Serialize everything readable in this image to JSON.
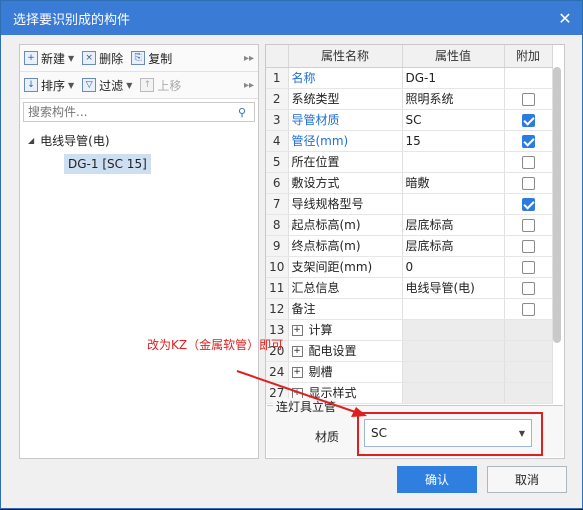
{
  "window": {
    "title": "选择要识别成的构件",
    "close_glyph": "✕"
  },
  "toolbar1": {
    "new_label": "新建",
    "delete_label": "删除",
    "copy_label": "复制"
  },
  "toolbar2": {
    "sort_label": "排序",
    "filter_label": "过滤",
    "up_label": "上移"
  },
  "search": {
    "placeholder": "搜索构件..."
  },
  "tree": {
    "parent_label": "电线导管(电)",
    "child_label": "DG-1 [SC 15]"
  },
  "table": {
    "headers": {
      "name": "属性名称",
      "value": "属性值",
      "extra": "附加"
    },
    "rows": [
      {
        "num": "1",
        "name": "名称",
        "value": "DG-1",
        "blue": true,
        "check": "none"
      },
      {
        "num": "2",
        "name": "系统类型",
        "value": "照明系统",
        "blue": false,
        "check": "off"
      },
      {
        "num": "3",
        "name": "导管材质",
        "value": "SC",
        "blue": true,
        "check": "on"
      },
      {
        "num": "4",
        "name": "管径(mm)",
        "value": "15",
        "blue": true,
        "check": "on"
      },
      {
        "num": "5",
        "name": "所在位置",
        "value": "",
        "blue": false,
        "check": "off"
      },
      {
        "num": "6",
        "name": "敷设方式",
        "value": "暗敷",
        "blue": false,
        "check": "off"
      },
      {
        "num": "7",
        "name": "导线规格型号",
        "value": "",
        "blue": false,
        "check": "on"
      },
      {
        "num": "8",
        "name": "起点标高(m)",
        "value": "层底标高",
        "blue": false,
        "check": "off"
      },
      {
        "num": "9",
        "name": "终点标高(m)",
        "value": "层底标高",
        "blue": false,
        "check": "off"
      },
      {
        "num": "10",
        "name": "支架间距(mm)",
        "value": "0",
        "blue": false,
        "check": "off"
      },
      {
        "num": "11",
        "name": "汇总信息",
        "value": "电线导管(电)",
        "blue": false,
        "check": "off"
      },
      {
        "num": "12",
        "name": "备注",
        "value": "",
        "blue": false,
        "check": "off"
      }
    ],
    "groups": [
      {
        "num": "13",
        "name": "计算"
      },
      {
        "num": "20",
        "name": "配电设置"
      },
      {
        "num": "24",
        "name": "剔槽"
      },
      {
        "num": "27",
        "name": "显示样式"
      }
    ]
  },
  "fieldset": {
    "title": "连灯具立管",
    "material_label": "材质",
    "material_value": "SC"
  },
  "annotation": {
    "text": "改为KZ（金属软管）即可"
  },
  "buttons": {
    "ok": "确认",
    "cancel": "取消"
  },
  "colors": {
    "accent": "#2f7fe0",
    "titlebar": "#3a7bd5",
    "annotation": "#e02020"
  }
}
